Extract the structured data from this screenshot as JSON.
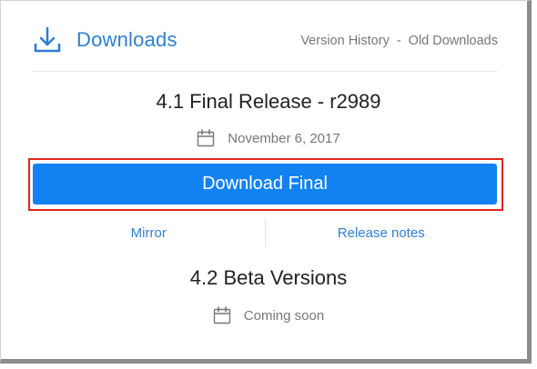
{
  "header": {
    "title": "Downloads",
    "links": [
      "Version History",
      "Old Downloads"
    ],
    "separator": "-"
  },
  "final_release": {
    "title": "4.1 Final Release - r2989",
    "date": "November 6, 2017",
    "download_label": "Download Final",
    "mirror_label": "Mirror",
    "release_notes_label": "Release notes"
  },
  "beta": {
    "title": "4.2 Beta Versions",
    "status": "Coming soon"
  },
  "colors": {
    "accent": "#2f7fd1",
    "button": "#1282f3",
    "highlight": "#e1241b"
  }
}
